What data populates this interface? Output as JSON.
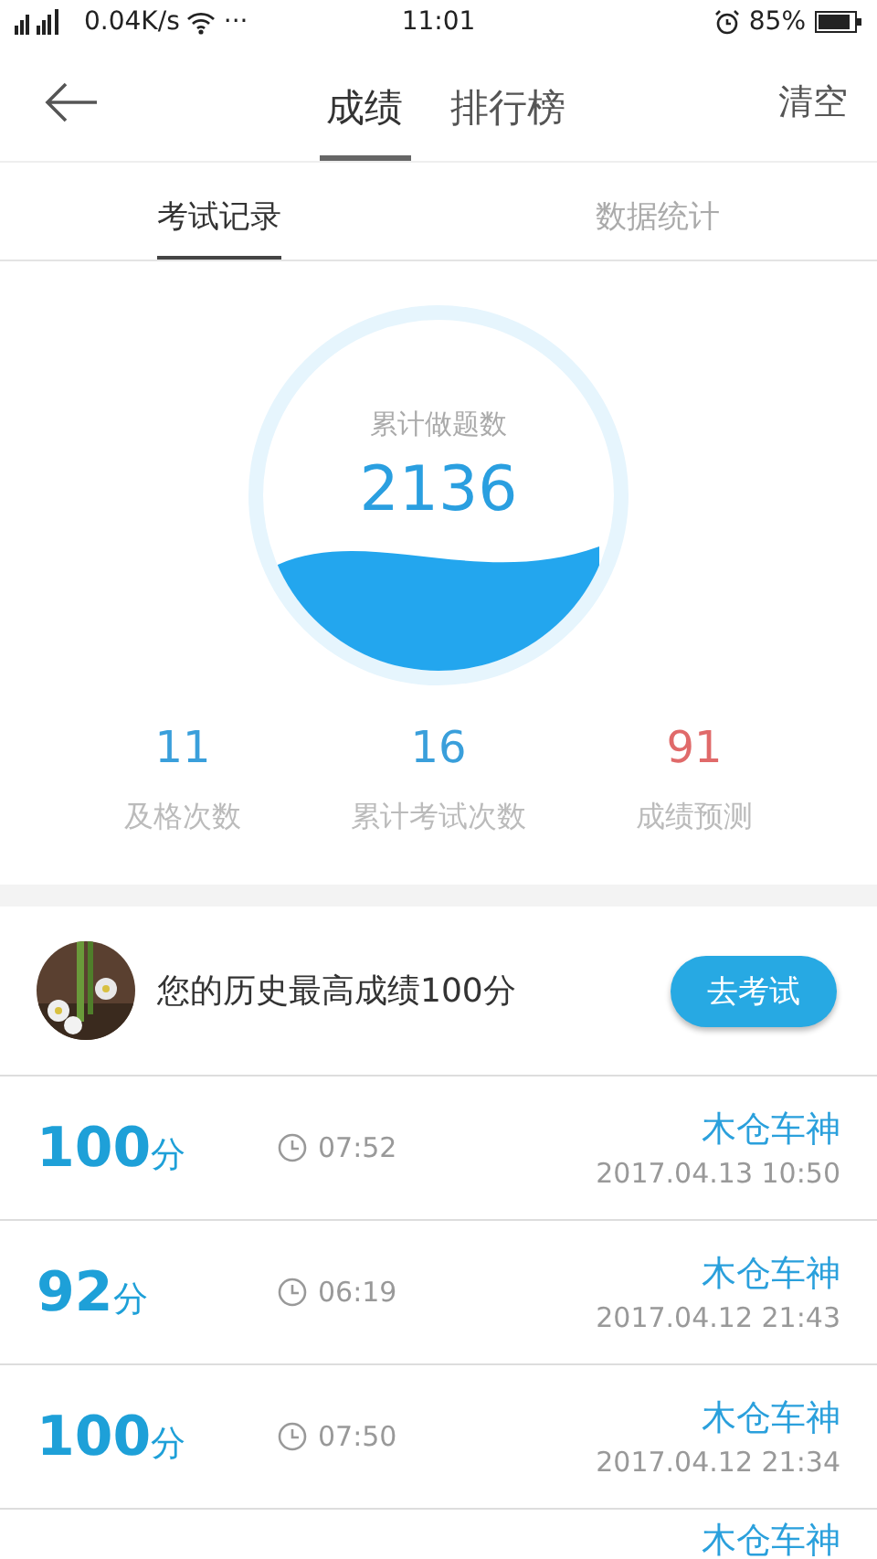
{
  "status_bar": {
    "network_speed": "0.04K/s",
    "more": "···",
    "time": "11:01",
    "battery": "85%"
  },
  "header": {
    "tabs": [
      {
        "label": "成绩",
        "selected": true
      },
      {
        "label": "排行榜",
        "selected": false
      }
    ],
    "action": "清空"
  },
  "sub_tabs": [
    {
      "label": "考试记录",
      "selected": true
    },
    {
      "label": "数据统计",
      "selected": false
    }
  ],
  "gauge": {
    "label": "累计做题数",
    "value": "2136"
  },
  "stats": [
    {
      "value": "11",
      "label": "及格次数",
      "color": "#3a9fdb"
    },
    {
      "value": "16",
      "label": "累计考试次数",
      "color": "#3a9fdb"
    },
    {
      "value": "91",
      "label": "成绩预测",
      "color": "#e06a6a"
    }
  ],
  "best": {
    "text": "您的历史最高成绩100分",
    "button": "去考试"
  },
  "records": [
    {
      "score": "100",
      "unit": "分",
      "duration": "07:52",
      "name": "木仓车神",
      "date": "2017.04.13  10:50"
    },
    {
      "score": "92",
      "unit": "分",
      "duration": "06:19",
      "name": "木仓车神",
      "date": "2017.04.12  21:43"
    },
    {
      "score": "100",
      "unit": "分",
      "duration": "07:50",
      "name": "木仓车神",
      "date": "2017.04.12  21:34"
    },
    {
      "name": "木仓车神"
    }
  ]
}
